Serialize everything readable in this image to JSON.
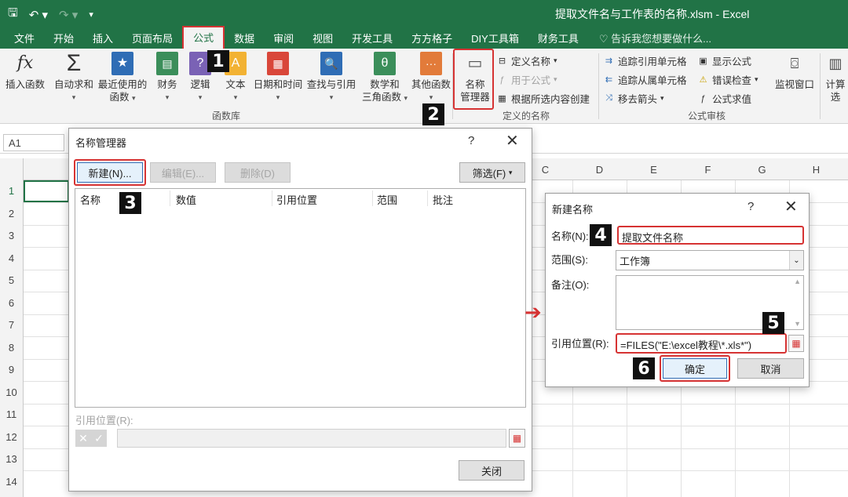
{
  "app": {
    "doc_title": "提取文件名与工作表的名称.xlsm - Excel",
    "qat": {
      "save_icon": "save-icon",
      "undo_icon": "undo-icon",
      "redo_icon": "redo-icon"
    }
  },
  "tabs": [
    "文件",
    "开始",
    "插入",
    "页面布局",
    "公式",
    "数据",
    "审阅",
    "视图",
    "开发工具",
    "方方格子",
    "DIY工具箱",
    "财务工具"
  ],
  "active_tab": "公式",
  "tell_me": "告诉我您想要做什么...",
  "ribbon": {
    "insert_function": "插入函数",
    "autosum": "自动求和",
    "recent": [
      "最近使用的",
      "函数"
    ],
    "financial": "财务",
    "logical": "逻辑",
    "text": "文本",
    "datetime": "日期和时间",
    "lookup": "查找与引用",
    "math": [
      "数学和",
      "三角函数"
    ],
    "more": "其他函数",
    "group_library": "函数库",
    "name_manager": [
      "名称",
      "管理器"
    ],
    "define_name": "定义名称",
    "use_in_formula": "用于公式",
    "create_from_selection": "根据所选内容创建",
    "group_defined_names": "定义的名称",
    "trace_precedents": "追踪引用单元格",
    "trace_dependents": "追踪从属单元格",
    "remove_arrows": "移去箭头",
    "show_formulas": "显示公式",
    "error_checking": "错误检查",
    "evaluate_formula": "公式求值",
    "group_auditing": "公式审核",
    "watch_window": "监视窗口",
    "calc_options": "计算选"
  },
  "formula_bar": {
    "name_box": "A1"
  },
  "grid": {
    "columns": [
      "C",
      "D",
      "E",
      "F",
      "G",
      "H"
    ],
    "rows": [
      "1",
      "2",
      "3",
      "4",
      "5",
      "6",
      "7",
      "8",
      "9",
      "10",
      "11",
      "12",
      "13",
      "14"
    ]
  },
  "name_manager_dialog": {
    "title": "名称管理器",
    "help": "?",
    "new_button": "新建(N)...",
    "edit_button": "编辑(E)...",
    "delete_button": "删除(D)",
    "filter_button": "筛选(F)",
    "columns": [
      "名称",
      "数值",
      "引用位置",
      "范围",
      "批注"
    ],
    "refers_to_label": "引用位置(R):",
    "close_button": "关闭"
  },
  "new_name_dialog": {
    "title": "新建名称",
    "help": "?",
    "name_label": "名称(N):",
    "name_value": "提取文件名称",
    "scope_label": "范围(S):",
    "scope_value": "工作簿",
    "comment_label": "备注(O):",
    "refers_label": "引用位置(R):",
    "refers_value": "=FILES(\"E:\\excel教程\\*.xls*\")",
    "ok_button": "确定",
    "cancel_button": "取消"
  },
  "steps": [
    "1",
    "2",
    "3",
    "4",
    "5",
    "6"
  ],
  "colors": {
    "excel_green": "#217346",
    "highlight_red": "#d63333",
    "badge_black": "#111111"
  }
}
